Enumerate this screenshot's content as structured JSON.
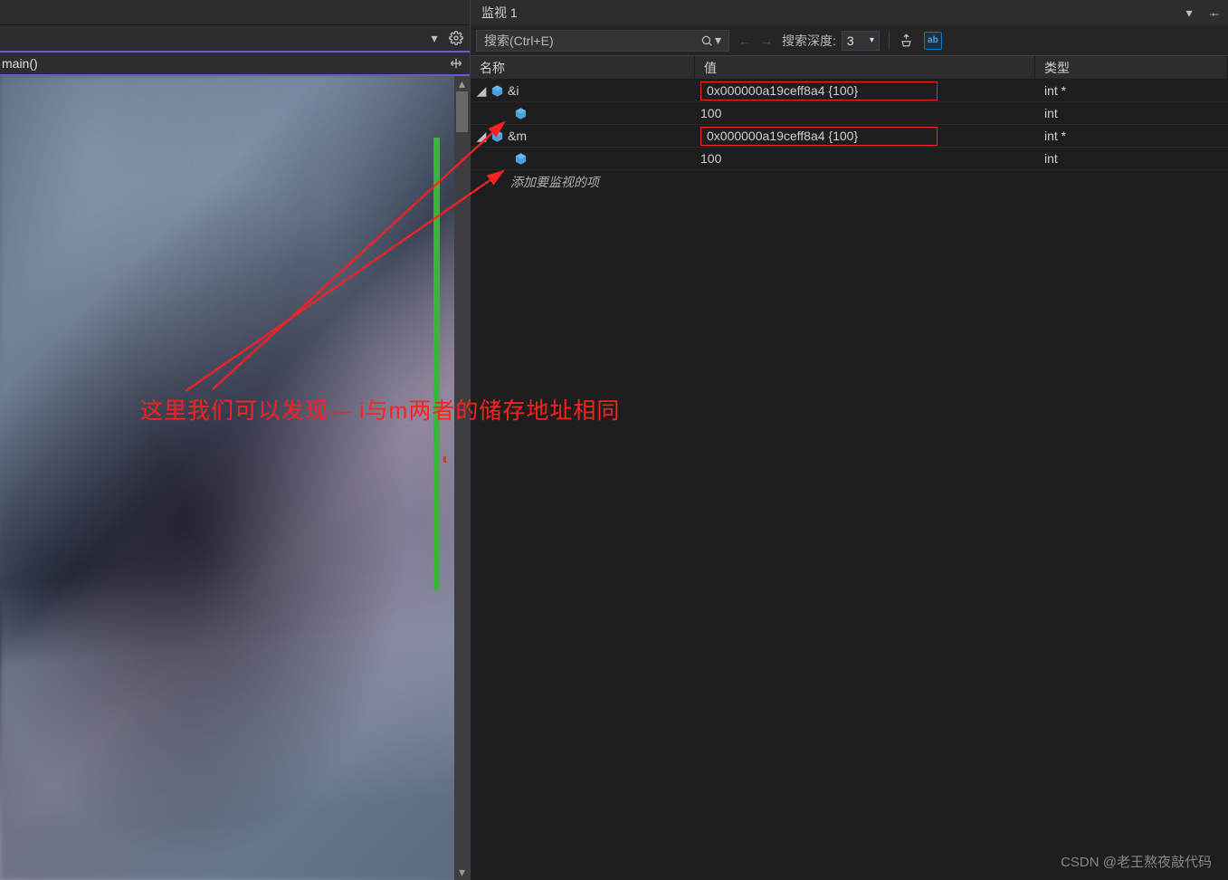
{
  "left": {
    "function_label": "main()"
  },
  "watch_panel": {
    "title": "监视 1",
    "search_placeholder": "搜索(Ctrl+E)",
    "depth_label": "搜索深度:",
    "depth_value": "3",
    "columns": {
      "name": "名称",
      "value": "值",
      "type": "类型"
    },
    "rows": [
      {
        "depth": 0,
        "expanded": true,
        "name": "&i",
        "value": "0x000000a19ceff8a4 {100}",
        "type": "int *",
        "boxed": true
      },
      {
        "depth": 1,
        "expanded": false,
        "name": "",
        "value": "100",
        "type": "int",
        "boxed": false
      },
      {
        "depth": 0,
        "expanded": true,
        "name": "&m",
        "value": "0x000000a19ceff8a4 {100}",
        "type": "int *",
        "boxed": true
      },
      {
        "depth": 1,
        "expanded": false,
        "name": "",
        "value": "100",
        "type": "int",
        "boxed": false
      }
    ],
    "add_item_label": "添加要监视的项"
  },
  "annotation": {
    "text": "这里我们可以发现— i与m两者的储存地址相同"
  },
  "watermark": "CSDN @老王熬夜敲代码"
}
